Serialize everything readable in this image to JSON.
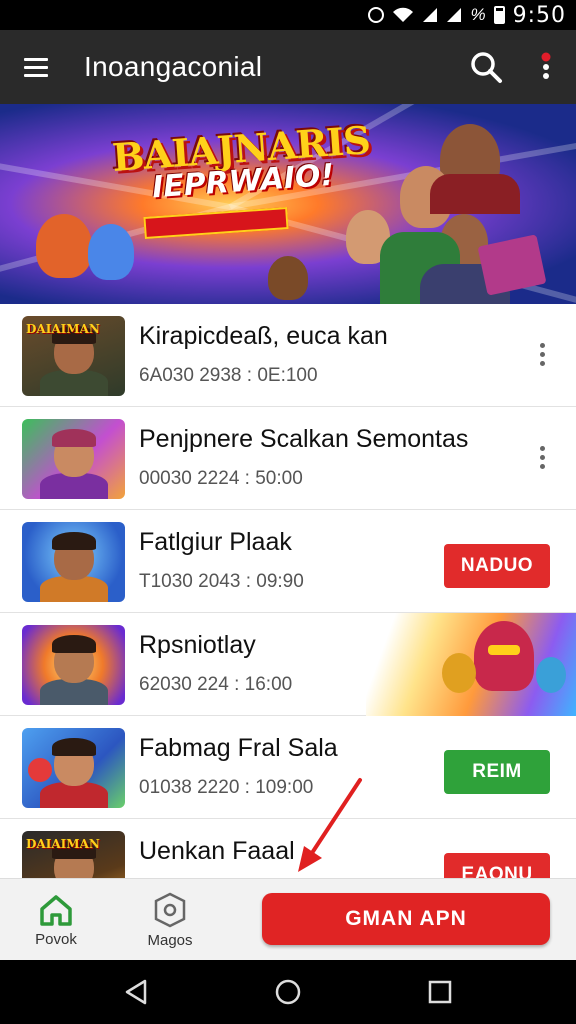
{
  "status_bar": {
    "battery_pct": "%",
    "time": "9:50",
    "icons": [
      "alarm-icon",
      "wifi-icon",
      "signal-icon",
      "signal-icon",
      "battery-icon"
    ]
  },
  "app_bar": {
    "title": "Inoangaconial",
    "icons": [
      "menu-icon",
      "search-icon",
      "more-vert-icon"
    ],
    "accent_dot_color": "#e11d2a"
  },
  "banner": {
    "title": "BAIAJNARIS",
    "subtitle": "IEPRWAIO!"
  },
  "list": [
    {
      "title": "Kirapicdeaß, euca kan",
      "meta": "6A030 2938 : 0E:100",
      "action": "more",
      "thumb_tag": "DAIAIMAN"
    },
    {
      "title": "Penjpnere Scalkan Semontas",
      "meta": "00030 2224 : 50:00",
      "action": "more",
      "thumb_tag": ""
    },
    {
      "title": "Fatlgiur Plaak",
      "meta": "T1030 2043 : 09:90",
      "action": "button",
      "button_label": "NADUO",
      "button_color": "#e12b2b",
      "thumb_tag": ""
    },
    {
      "title": "Rpsniotlay",
      "meta": "62030 224 : 16:00",
      "action": "art",
      "thumb_tag": ""
    },
    {
      "title": "Fabmag Fral Sala",
      "meta": "01038 2220 : 109:00",
      "action": "button",
      "button_label": "REIM",
      "button_color": "#2fa23a",
      "thumb_tag": ""
    },
    {
      "title": "Uenkan Faaal",
      "meta": "",
      "action": "button",
      "button_label": "EAONU",
      "button_color": "#e12b2b",
      "thumb_tag": "DAIAIMAN"
    }
  ],
  "bottom_nav": {
    "items": [
      {
        "label": "Povok",
        "icon": "home-icon",
        "color": "#2e9a3a"
      },
      {
        "label": "Magos",
        "icon": "shield-icon",
        "color": "#555555"
      }
    ],
    "cta_label": "GMAN APN",
    "cta_color": "#e02424"
  },
  "system_nav": {
    "icons": [
      "back-icon",
      "home-circle-icon",
      "recents-icon"
    ]
  }
}
